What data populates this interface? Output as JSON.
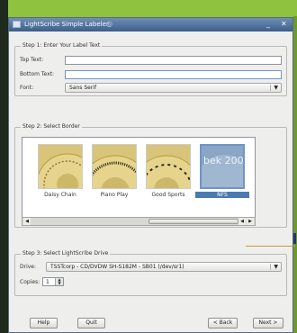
{
  "window": {
    "title": "LightScribe Simple Labeler",
    "buttons": {
      "minimize": "_",
      "close": "✕"
    }
  },
  "step1": {
    "legend": "Step 1: Enter Your Label Text",
    "top_text_label": "Top Text:",
    "top_text_value": "",
    "bottom_text_label": "Bottom Text:",
    "bottom_text_value": "",
    "font_label": "Font:",
    "font_value": "Sans Serif"
  },
  "step2": {
    "legend": "Step 2: Select Border",
    "borders": [
      {
        "label": "Daisy Chain",
        "selected": false
      },
      {
        "label": "Piano Play",
        "selected": false
      },
      {
        "label": "Good Sports",
        "selected": false
      },
      {
        "label": "NFS",
        "selected": true,
        "art_text": "bek 200"
      }
    ]
  },
  "step3": {
    "legend": "Step 3: Select LightScribe Drive",
    "drive_label": "Drive:",
    "drive_value": "TSSTcorp - CD/DVDW SH-S182M - SB01 (/dev/sr1)",
    "copies_label": "Copies:",
    "copies_value": "1"
  },
  "footer": {
    "help": "Help",
    "quit": "Quit",
    "back": "< Back",
    "next": "Next >"
  },
  "colors": {
    "background": "#8fc23e",
    "titlebar": "#3c5e8a",
    "selection": "#4b79b0"
  }
}
